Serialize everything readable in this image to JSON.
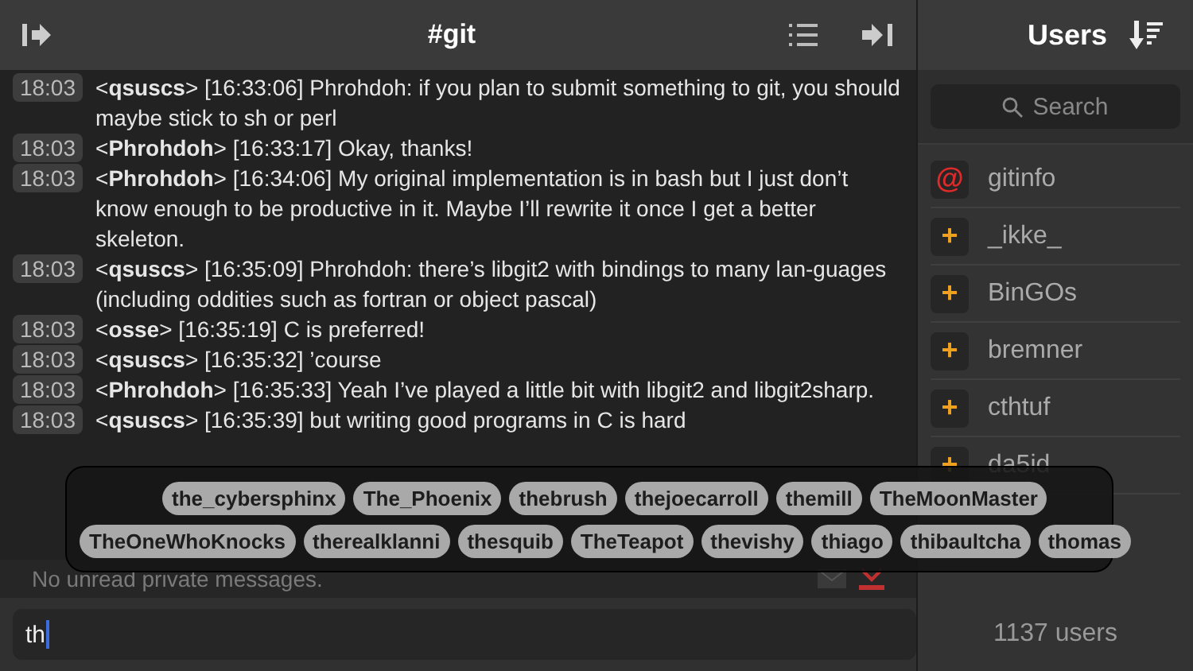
{
  "header": {
    "title": "#git"
  },
  "messages": [
    {
      "time": "18:03",
      "text": "<**qsuscs**> [16:33:06] Phrohdoh: if you plan to submit something to git, you should maybe stick to sh or perl"
    },
    {
      "time": "18:03",
      "text": "<**Phrohdoh**> [16:33:17] Okay, thanks!"
    },
    {
      "time": "18:03",
      "text": "<**Phrohdoh**> [16:34:06] My original implementation is in bash but I just don’t know enough to be productive in it. Maybe I’ll rewrite it once I get a better skeleton."
    },
    {
      "time": "18:03",
      "text": "<**qsuscs**> [16:35:09] Phrohdoh: there’s libgit2 with bindings to many lan-guages (including oddities such as fortran or object pascal)"
    },
    {
      "time": "18:03",
      "text": "<**osse**> [16:35:19] C is preferred!"
    },
    {
      "time": "18:03",
      "text": "<**qsuscs**> [16:35:32] ’course"
    },
    {
      "time": "18:03",
      "text": "<**Phrohdoh**> [16:35:33] Yeah I’ve played a little bit with libgit2 and libgit2sharp."
    },
    {
      "time": "18:03",
      "text": "<**qsuscs**> [16:35:39] but writing good programs in C is hard"
    }
  ],
  "status": "No unread private messages.",
  "input": {
    "value": "th"
  },
  "completions": [
    [
      "the_cybersphinx",
      "The_Phoenix",
      "thebrush",
      "thejoecarroll",
      "themill",
      "TheMoonMaster"
    ],
    [
      "TheOneWhoKnocks",
      "therealklanni",
      "thesquib",
      "TheTeapot",
      "thevishy",
      "thiago",
      "thibaultcha",
      "thomas"
    ]
  ],
  "sidebar": {
    "title": "Users",
    "search": {
      "placeholder": "Search"
    },
    "users": [
      {
        "name": "gitinfo",
        "kind": "op",
        "badge": "@"
      },
      {
        "name": "_ikke_",
        "kind": "voice",
        "badge": "+"
      },
      {
        "name": "BinGOs",
        "kind": "voice",
        "badge": "+"
      },
      {
        "name": "bremner",
        "kind": "voice",
        "badge": "+"
      },
      {
        "name": "cthtuf",
        "kind": "voice",
        "badge": "+"
      },
      {
        "name": "da5id",
        "kind": "voice",
        "badge": "+"
      }
    ],
    "count": "1137 users"
  }
}
